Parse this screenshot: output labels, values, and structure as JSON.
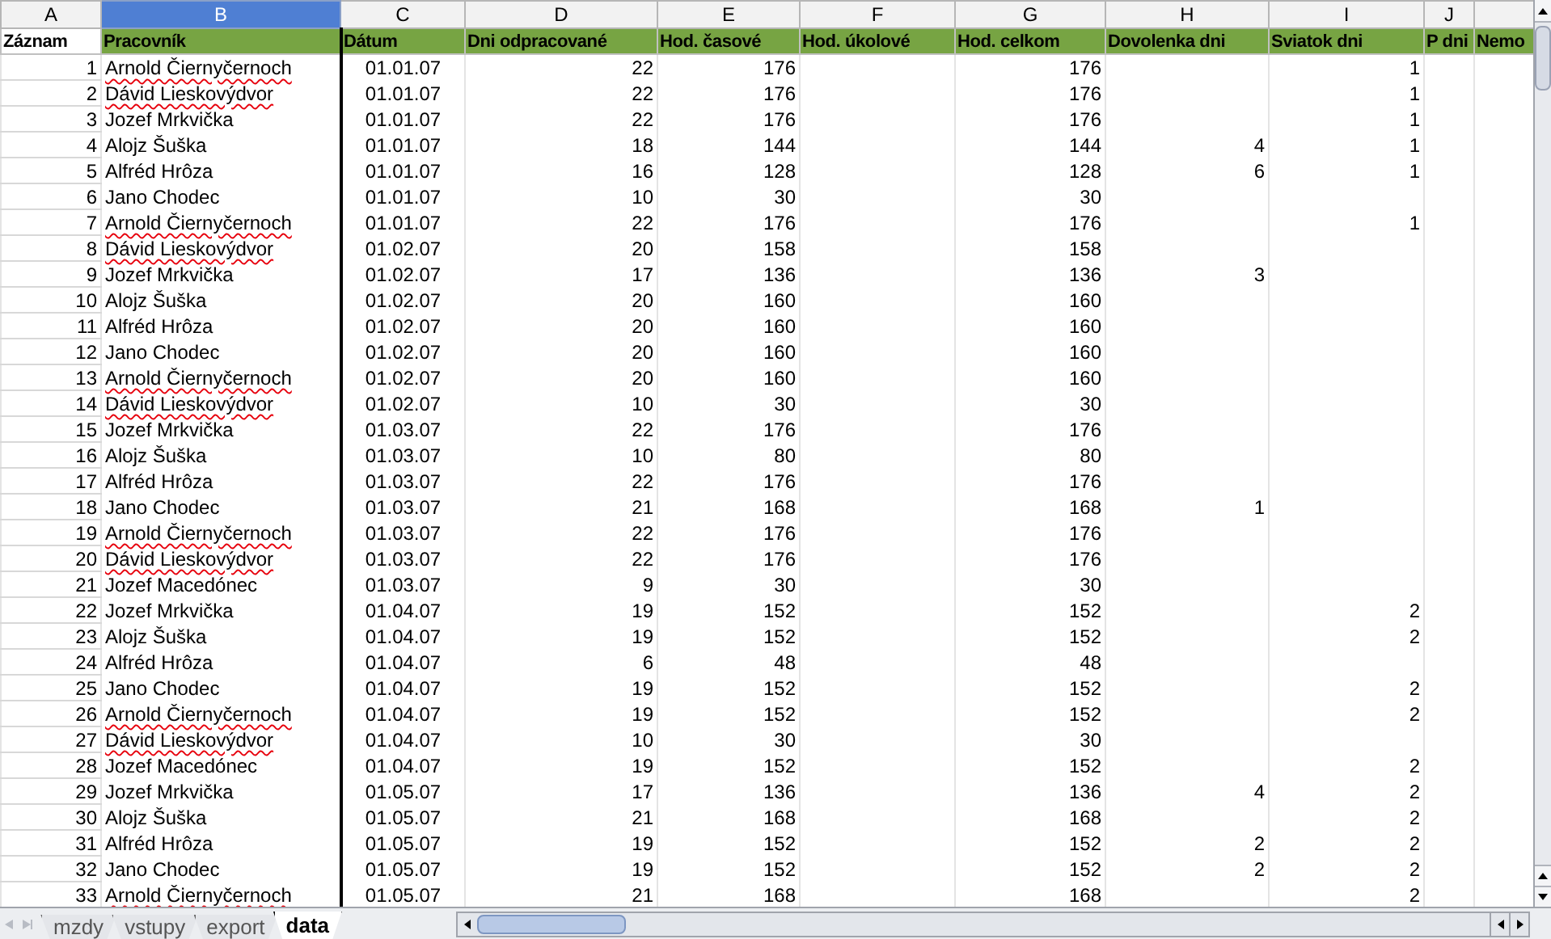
{
  "columns": [
    {
      "letter": "A",
      "heading": "Záznam",
      "selected": false
    },
    {
      "letter": "B",
      "heading": "Pracovník",
      "selected": true
    },
    {
      "letter": "C",
      "heading": "Dátum",
      "selected": false
    },
    {
      "letter": "D",
      "heading": "Dni odpracované",
      "selected": false
    },
    {
      "letter": "E",
      "heading": "Hod. časové",
      "selected": false
    },
    {
      "letter": "F",
      "heading": "Hod. úkolové",
      "selected": false
    },
    {
      "letter": "G",
      "heading": "Hod. celkom",
      "selected": false
    },
    {
      "letter": "H",
      "heading": "Dovolenka dni",
      "selected": false
    },
    {
      "letter": "I",
      "heading": "Sviatok dni",
      "selected": false
    },
    {
      "letter": "J",
      "heading": "P dni",
      "selected": false
    },
    {
      "heading": "Nemo",
      "selected": false
    }
  ],
  "rows": [
    {
      "A": "1",
      "B": "Arnold Čiernyčernoch",
      "spell_flag": true,
      "C": "01.01.07",
      "D": "22",
      "E": "176",
      "G": "176",
      "I": "1"
    },
    {
      "A": "2",
      "B": "Dávid Lieskovýdvor",
      "spell_flag": true,
      "C": "01.01.07",
      "D": "22",
      "E": "176",
      "G": "176",
      "I": "1"
    },
    {
      "A": "3",
      "B": "Jozef Mrkvička",
      "spell_flag": false,
      "C": "01.01.07",
      "D": "22",
      "E": "176",
      "G": "176",
      "I": "1"
    },
    {
      "A": "4",
      "B": "Alojz Šuška",
      "spell_flag": false,
      "C": "01.01.07",
      "D": "18",
      "E": "144",
      "G": "144",
      "H": "4",
      "I": "1"
    },
    {
      "A": "5",
      "B": "Alfréd Hrôza",
      "spell_flag": false,
      "C": "01.01.07",
      "D": "16",
      "E": "128",
      "G": "128",
      "H": "6",
      "I": "1"
    },
    {
      "A": "6",
      "B": "Jano Chodec",
      "spell_flag": false,
      "C": "01.01.07",
      "D": "10",
      "E": "30",
      "G": "30"
    },
    {
      "A": "7",
      "B": "Arnold Čiernyčernoch",
      "spell_flag": true,
      "C": "01.01.07",
      "D": "22",
      "E": "176",
      "G": "176",
      "I": "1"
    },
    {
      "A": "8",
      "B": "Dávid Lieskovýdvor",
      "spell_flag": true,
      "C": "01.02.07",
      "D": "20",
      "E": "158",
      "G": "158"
    },
    {
      "A": "9",
      "B": "Jozef Mrkvička",
      "spell_flag": false,
      "C": "01.02.07",
      "D": "17",
      "E": "136",
      "G": "136",
      "H": "3"
    },
    {
      "A": "10",
      "B": "Alojz Šuška",
      "spell_flag": false,
      "C": "01.02.07",
      "D": "20",
      "E": "160",
      "G": "160"
    },
    {
      "A": "11",
      "B": "Alfréd Hrôza",
      "spell_flag": false,
      "C": "01.02.07",
      "D": "20",
      "E": "160",
      "G": "160"
    },
    {
      "A": "12",
      "B": "Jano Chodec",
      "spell_flag": false,
      "C": "01.02.07",
      "D": "20",
      "E": "160",
      "G": "160"
    },
    {
      "A": "13",
      "B": "Arnold Čiernyčernoch",
      "spell_flag": true,
      "C": "01.02.07",
      "D": "20",
      "E": "160",
      "G": "160"
    },
    {
      "A": "14",
      "B": "Dávid Lieskovýdvor",
      "spell_flag": true,
      "C": "01.02.07",
      "D": "10",
      "E": "30",
      "G": "30"
    },
    {
      "A": "15",
      "B": "Jozef Mrkvička",
      "spell_flag": false,
      "C": "01.03.07",
      "D": "22",
      "E": "176",
      "G": "176"
    },
    {
      "A": "16",
      "B": "Alojz Šuška",
      "spell_flag": false,
      "C": "01.03.07",
      "D": "10",
      "E": "80",
      "G": "80"
    },
    {
      "A": "17",
      "B": "Alfréd Hrôza",
      "spell_flag": false,
      "C": "01.03.07",
      "D": "22",
      "E": "176",
      "G": "176"
    },
    {
      "A": "18",
      "B": "Jano Chodec",
      "spell_flag": false,
      "C": "01.03.07",
      "D": "21",
      "E": "168",
      "G": "168",
      "H": "1"
    },
    {
      "A": "19",
      "B": "Arnold Čiernyčernoch",
      "spell_flag": true,
      "C": "01.03.07",
      "D": "22",
      "E": "176",
      "G": "176"
    },
    {
      "A": "20",
      "B": "Dávid Lieskovýdvor",
      "spell_flag": true,
      "C": "01.03.07",
      "D": "22",
      "E": "176",
      "G": "176"
    },
    {
      "A": "21",
      "B": "Jozef Macedónec",
      "spell_flag": false,
      "C": "01.03.07",
      "D": "9",
      "E": "30",
      "G": "30"
    },
    {
      "A": "22",
      "B": "Jozef Mrkvička",
      "spell_flag": false,
      "C": "01.04.07",
      "D": "19",
      "E": "152",
      "G": "152",
      "I": "2"
    },
    {
      "A": "23",
      "B": "Alojz Šuška",
      "spell_flag": false,
      "C": "01.04.07",
      "D": "19",
      "E": "152",
      "G": "152",
      "I": "2"
    },
    {
      "A": "24",
      "B": "Alfréd Hrôza",
      "spell_flag": false,
      "C": "01.04.07",
      "D": "6",
      "E": "48",
      "G": "48"
    },
    {
      "A": "25",
      "B": "Jano Chodec",
      "spell_flag": false,
      "C": "01.04.07",
      "D": "19",
      "E": "152",
      "G": "152",
      "I": "2"
    },
    {
      "A": "26",
      "B": "Arnold Čiernyčernoch",
      "spell_flag": true,
      "C": "01.04.07",
      "D": "19",
      "E": "152",
      "G": "152",
      "I": "2"
    },
    {
      "A": "27",
      "B": "Dávid Lieskovýdvor",
      "spell_flag": true,
      "C": "01.04.07",
      "D": "10",
      "E": "30",
      "G": "30"
    },
    {
      "A": "28",
      "B": "Jozef Macedónec",
      "spell_flag": false,
      "C": "01.04.07",
      "D": "19",
      "E": "152",
      "G": "152",
      "I": "2"
    },
    {
      "A": "29",
      "B": "Jozef Mrkvička",
      "spell_flag": false,
      "C": "01.05.07",
      "D": "17",
      "E": "136",
      "G": "136",
      "H": "4",
      "I": "2"
    },
    {
      "A": "30",
      "B": "Alojz Šuška",
      "spell_flag": false,
      "C": "01.05.07",
      "D": "21",
      "E": "168",
      "G": "168",
      "I": "2"
    },
    {
      "A": "31",
      "B": "Alfréd Hrôza",
      "spell_flag": false,
      "C": "01.05.07",
      "D": "19",
      "E": "152",
      "G": "152",
      "H": "2",
      "I": "2"
    },
    {
      "A": "32",
      "B": "Jano Chodec",
      "spell_flag": false,
      "C": "01.05.07",
      "D": "19",
      "E": "152",
      "G": "152",
      "H": "2",
      "I": "2"
    },
    {
      "A": "33",
      "B": "Arnold Čiernyčernoch",
      "spell_flag": true,
      "C": "01.05.07",
      "D": "21",
      "E": "168",
      "G": "168",
      "I": "2"
    }
  ],
  "sheet_tabs": [
    {
      "label": "mzdy",
      "selected": false
    },
    {
      "label": "vstupy",
      "selected": false
    },
    {
      "label": "export",
      "selected": false
    },
    {
      "label": "data",
      "selected": true
    }
  ]
}
